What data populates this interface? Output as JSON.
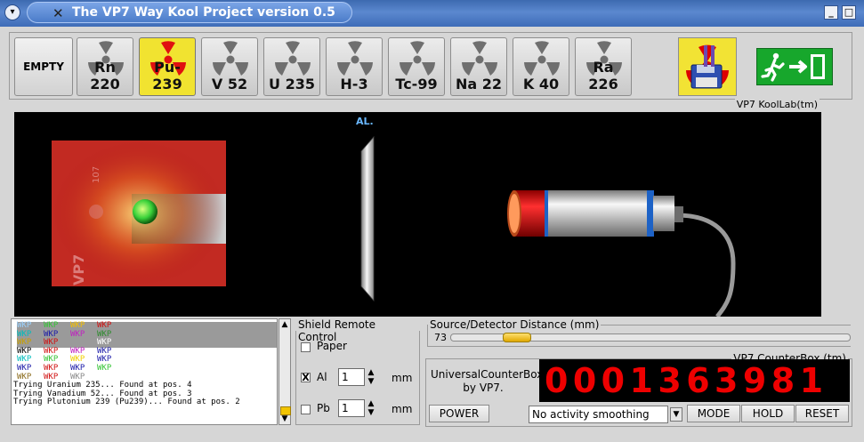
{
  "window": {
    "title": "The VP7 Way Kool Project version 0.5"
  },
  "toolbar": {
    "empty_label": "EMPTY",
    "sources": [
      {
        "label": "Rn 220",
        "selected": false
      },
      {
        "label": "Pu-239",
        "selected": true
      },
      {
        "label": "V 52",
        "selected": false
      },
      {
        "label": "U 235",
        "selected": false
      },
      {
        "label": "H-3",
        "selected": false
      },
      {
        "label": "Tc-99",
        "selected": false
      },
      {
        "label": "Na 22",
        "selected": false
      },
      {
        "label": "K 40",
        "selected": false
      },
      {
        "label": "Ra 226",
        "selected": false
      }
    ]
  },
  "lab": {
    "caption": "VP7 KoolLab(tm)",
    "shield_label": "AL.",
    "holder_text": "VP7",
    "holder_number": "107"
  },
  "log": {
    "grid": [
      [
        "WKP",
        "WKP",
        "WKP",
        "WKP"
      ],
      [
        "WKP",
        "WKP",
        "WKP",
        "WKP"
      ],
      [
        "WKP",
        "WKP",
        "",
        "WKP"
      ],
      [
        "WKP",
        "WKP",
        "WKP",
        "WKP"
      ],
      [
        "WKP",
        "WKP",
        "WKP",
        "WKP"
      ],
      [
        "WKP",
        "WKP",
        "WKP",
        "WKP"
      ],
      [
        "WKP",
        "WKP",
        "WKP",
        ""
      ]
    ],
    "grid_colors": [
      [
        "#9ad2ff",
        "#35c435",
        "#f5c000",
        "#d01010"
      ],
      [
        "#00bcbc",
        "#1a1aa8",
        "#c020c0",
        "#2e8b2e"
      ],
      [
        "#c8a000",
        "#d01010",
        "",
        "#ffffff"
      ],
      [
        "#000000",
        "#d01010",
        "#c020c0",
        "#1a1aa8"
      ],
      [
        "#00bcbc",
        "#35c435",
        "#f0d000",
        "#1a1aa8"
      ],
      [
        "#1a1aa8",
        "#d01010",
        "#1a1aa8",
        "#35c435"
      ],
      [
        "#8a6a1a",
        "#d01010",
        "#8a8a8a",
        ""
      ]
    ],
    "messages": [
      "Trying Uranium 235... Found at pos. 4",
      "Trying Vanadium 52... Found at pos. 3",
      "Trying Plutonium 239 (Pu239)... Found at pos. 2"
    ]
  },
  "shield": {
    "legend": "Shield Remote Control",
    "paper": {
      "label": "Paper",
      "checked": false
    },
    "al": {
      "label": "Al",
      "checked": true,
      "value": "1",
      "unit": "mm",
      "check_mark": "X"
    },
    "pb": {
      "label": "Pb",
      "checked": false,
      "value": "1",
      "unit": "mm"
    }
  },
  "distance": {
    "legend": "Source/Detector Distance (mm)",
    "value": "73"
  },
  "counter": {
    "legend": "VP7 CounterBox (tm)",
    "brand_line1": "UniversalCounterBox",
    "brand_line2": "by VP7.",
    "count": "0001363981",
    "power_label": "POWER",
    "smoothing": "No activity smoothing",
    "mode_label": "MODE",
    "hold_label": "HOLD",
    "reset_label": "RESET"
  },
  "colors": {
    "titlebar": "#4a78c2",
    "selected_source": "#f1e330",
    "lcd_digits": "#ee0000",
    "exit_sign": "#17a72c"
  }
}
